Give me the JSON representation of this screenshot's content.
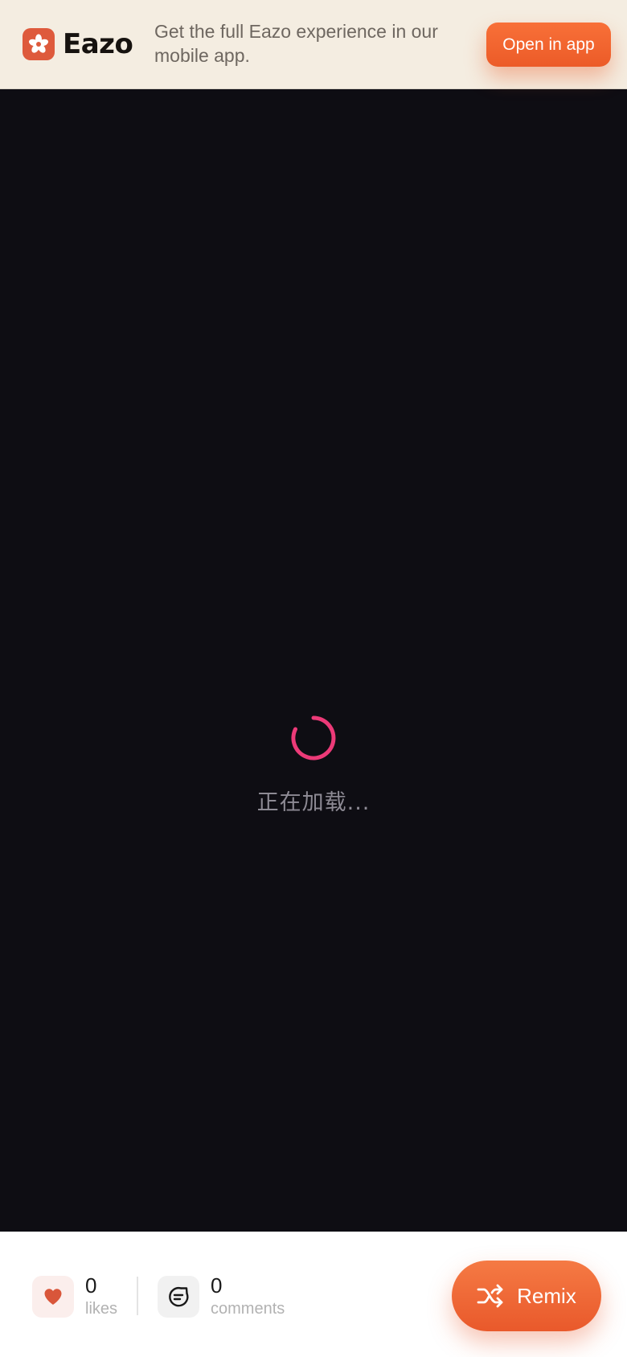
{
  "banner": {
    "logo_text": "Eazo",
    "message": "Get the full Eazo experience in our mobile app.",
    "open_button_label": "Open in app"
  },
  "loader": {
    "text": "正在加载..."
  },
  "stats": {
    "likes_count": "0",
    "likes_label": "likes",
    "comments_count": "0",
    "comments_label": "comments"
  },
  "actions": {
    "remix_label": "Remix"
  },
  "colors": {
    "accent": "#ef6230",
    "spinner": "#ec3a78",
    "background": "#0e0d13",
    "banner_background": "#f4ede1"
  },
  "icons": {
    "logo": "asterisk-flower-icon",
    "like": "heart-icon",
    "comment": "chat-bubble-icon",
    "remix": "shuffle-icon",
    "loading": "spinner-icon"
  }
}
